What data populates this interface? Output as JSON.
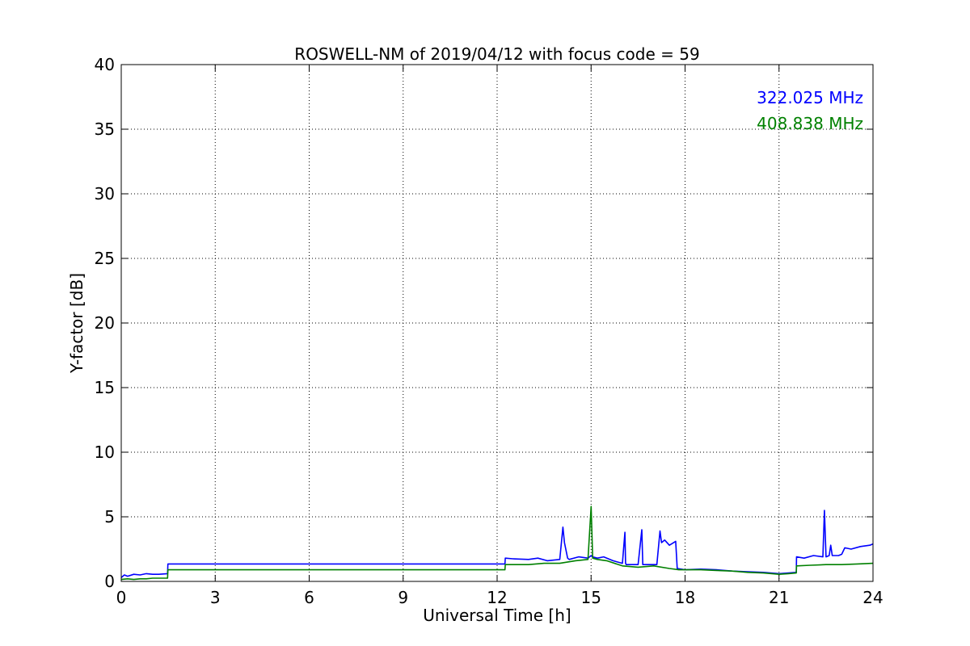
{
  "chart_data": {
    "type": "line",
    "title": "ROSWELL-NM of 2019/04/12 with focus code = 59",
    "xlabel": "Universal Time [h]",
    "ylabel": "Y-factor [dB]",
    "xlim": [
      0,
      24
    ],
    "ylim": [
      0,
      40
    ],
    "xticks": [
      0,
      3,
      6,
      9,
      12,
      15,
      18,
      21,
      24
    ],
    "yticks": [
      0,
      5,
      10,
      15,
      20,
      25,
      30,
      35,
      40
    ],
    "grid": true,
    "legend_position": "top-right",
    "series": [
      {
        "name": "322.025 MHz",
        "color": "#0000ff",
        "x": [
          0,
          0.1,
          0.2,
          0.4,
          0.6,
          0.8,
          1.0,
          1.2,
          1.48,
          1.49,
          12.25,
          12.26,
          12.5,
          13.0,
          13.3,
          13.6,
          14.0,
          14.1,
          14.15,
          14.25,
          14.3,
          14.6,
          14.9,
          15.0,
          15.05,
          15.2,
          15.4,
          15.7,
          16.0,
          16.08,
          16.1,
          16.12,
          16.2,
          16.5,
          16.62,
          16.65,
          16.68,
          16.8,
          17.1,
          17.2,
          17.25,
          17.35,
          17.5,
          17.7,
          17.75,
          18.0,
          18.5,
          19.0,
          19.5,
          20.0,
          20.5,
          21.0,
          21.3,
          21.55,
          21.56,
          21.8,
          22.1,
          22.4,
          22.45,
          22.5,
          22.6,
          22.65,
          22.7,
          22.9,
          23.0,
          23.1,
          23.3,
          23.6,
          23.9,
          24.0
        ],
        "y": [
          0.3,
          0.5,
          0.4,
          0.55,
          0.5,
          0.6,
          0.55,
          0.55,
          0.6,
          1.35,
          1.35,
          1.8,
          1.75,
          1.7,
          1.8,
          1.6,
          1.7,
          4.2,
          3.0,
          1.8,
          1.7,
          1.9,
          1.8,
          2.0,
          1.9,
          1.8,
          1.9,
          1.6,
          1.4,
          3.8,
          1.4,
          1.3,
          1.3,
          1.3,
          4.0,
          1.3,
          1.3,
          1.3,
          1.3,
          3.9,
          3.0,
          3.2,
          2.8,
          3.1,
          1.0,
          0.9,
          0.95,
          0.9,
          0.8,
          0.75,
          0.7,
          0.6,
          0.65,
          0.7,
          1.9,
          1.8,
          2.0,
          1.9,
          5.5,
          1.9,
          2.0,
          2.8,
          2.0,
          2.0,
          2.1,
          2.6,
          2.5,
          2.7,
          2.8,
          2.9
        ]
      },
      {
        "name": "408.838 MHz",
        "color": "#008000",
        "x": [
          0,
          0.2,
          0.4,
          0.6,
          0.8,
          1.0,
          1.2,
          1.48,
          1.49,
          12.25,
          12.26,
          12.5,
          13.0,
          13.5,
          14.0,
          14.5,
          14.9,
          15.0,
          15.05,
          15.2,
          15.5,
          16.0,
          16.5,
          17.0,
          17.5,
          17.8,
          18.0,
          18.5,
          19.0,
          19.5,
          20.0,
          20.5,
          21.0,
          21.3,
          21.55,
          21.56,
          22.0,
          22.5,
          23.0,
          23.5,
          24.0
        ],
        "y": [
          0.15,
          0.2,
          0.15,
          0.2,
          0.2,
          0.25,
          0.25,
          0.25,
          0.9,
          0.9,
          1.3,
          1.3,
          1.3,
          1.4,
          1.4,
          1.6,
          1.7,
          5.8,
          1.8,
          1.7,
          1.6,
          1.2,
          1.1,
          1.2,
          1.0,
          0.9,
          0.9,
          0.9,
          0.85,
          0.8,
          0.7,
          0.65,
          0.55,
          0.6,
          0.65,
          1.2,
          1.25,
          1.3,
          1.3,
          1.35,
          1.4
        ]
      }
    ]
  }
}
